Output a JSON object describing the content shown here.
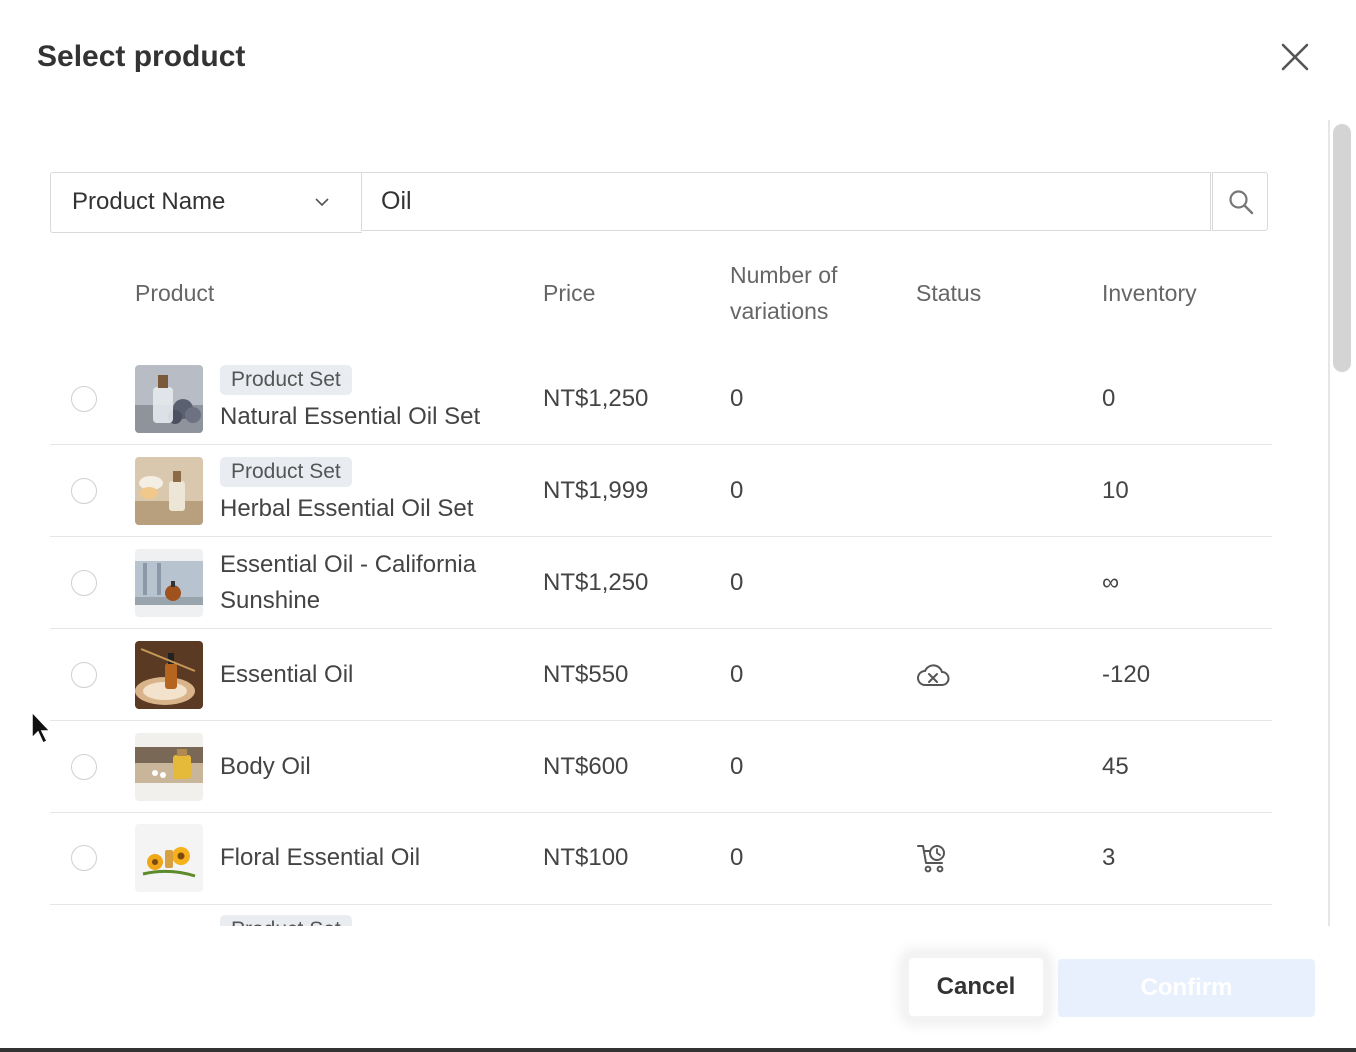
{
  "dialog": {
    "title": "Select product",
    "close_icon": "close-icon"
  },
  "search": {
    "field_label": "Product Name",
    "field_icon": "chevron-down-icon",
    "query": "Oil",
    "button_icon": "search-icon"
  },
  "table": {
    "headers": {
      "product": "Product",
      "price": "Price",
      "variations_line1": "Number of",
      "variations_line2": "variations",
      "status": "Status",
      "inventory": "Inventory"
    },
    "rows": [
      {
        "badge": "Product Set",
        "name": "Natural Essential Oil Set",
        "price": "NT$1,250",
        "variations": "0",
        "status_icon": "",
        "inventory": "0"
      },
      {
        "badge": "Product Set",
        "name": "Herbal Essential Oil Set",
        "price": "NT$1,999",
        "variations": "0",
        "status_icon": "",
        "inventory": "10"
      },
      {
        "badge": "",
        "name_line1": "Essential Oil - California",
        "name_line2": "Sunshine",
        "price": "NT$1,250",
        "variations": "0",
        "status_icon": "",
        "inventory": "∞"
      },
      {
        "badge": "",
        "name": "Essential Oil",
        "price": "NT$550",
        "variations": "0",
        "status_icon": "cloud-off-icon",
        "inventory": "-120"
      },
      {
        "badge": "",
        "name": "Body Oil",
        "price": "NT$600",
        "variations": "0",
        "status_icon": "",
        "inventory": "45"
      },
      {
        "badge": "",
        "name": "Floral Essential Oil",
        "price": "NT$100",
        "variations": "0",
        "status_icon": "cart-clock-icon",
        "inventory": "3"
      }
    ],
    "next_row_badge": "Product Set"
  },
  "footer": {
    "cancel_label": "Cancel",
    "confirm_label": "Confirm"
  },
  "colors": {
    "confirm_disabled_bg": "#e7f0fc",
    "border": "#d9d9d9"
  }
}
